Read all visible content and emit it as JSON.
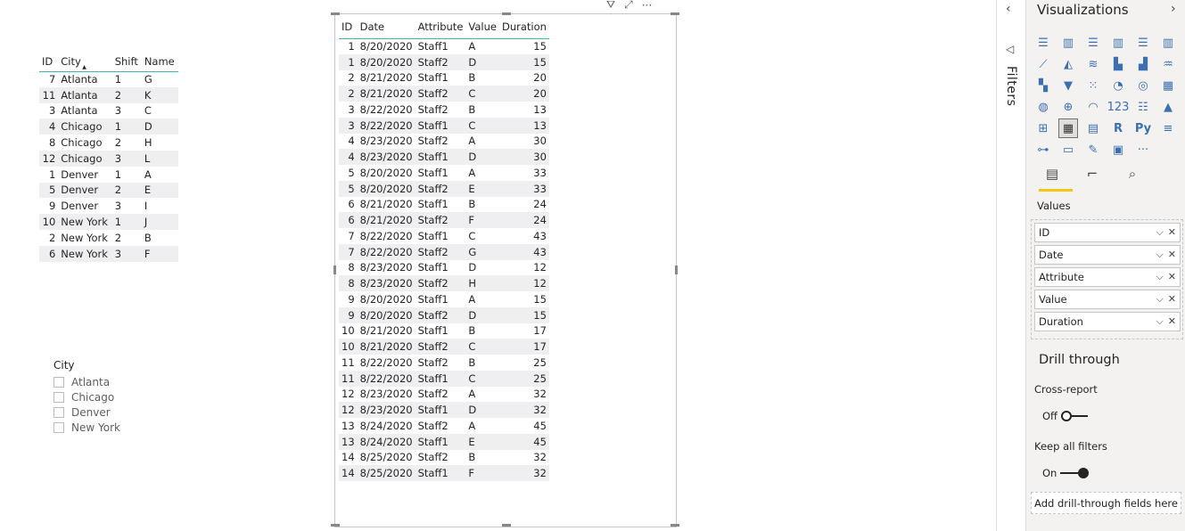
{
  "left_table": {
    "headers": [
      "ID",
      "City",
      "Shift",
      "Name"
    ],
    "rows": [
      [
        "7",
        "Atlanta",
        "1",
        "G"
      ],
      [
        "11",
        "Atlanta",
        "2",
        "K"
      ],
      [
        "3",
        "Atlanta",
        "3",
        "C"
      ],
      [
        "4",
        "Chicago",
        "1",
        "D"
      ],
      [
        "8",
        "Chicago",
        "2",
        "H"
      ],
      [
        "12",
        "Chicago",
        "3",
        "L"
      ],
      [
        "1",
        "Denver",
        "1",
        "A"
      ],
      [
        "5",
        "Denver",
        "2",
        "E"
      ],
      [
        "9",
        "Denver",
        "3",
        "I"
      ],
      [
        "10",
        "New York",
        "1",
        "J"
      ],
      [
        "2",
        "New York",
        "2",
        "B"
      ],
      [
        "6",
        "New York",
        "3",
        "F"
      ]
    ]
  },
  "slicer": {
    "title": "City",
    "items": [
      "Atlanta",
      "Chicago",
      "Denver",
      "New York"
    ]
  },
  "main_table": {
    "headers": [
      "ID",
      "Date",
      "Attribute",
      "Value",
      "Duration"
    ],
    "rows": [
      [
        "1",
        "8/20/2020",
        "Staff1",
        "A",
        "15"
      ],
      [
        "1",
        "8/20/2020",
        "Staff2",
        "D",
        "15"
      ],
      [
        "2",
        "8/21/2020",
        "Staff1",
        "B",
        "20"
      ],
      [
        "2",
        "8/21/2020",
        "Staff2",
        "C",
        "20"
      ],
      [
        "3",
        "8/22/2020",
        "Staff2",
        "B",
        "13"
      ],
      [
        "3",
        "8/22/2020",
        "Staff1",
        "C",
        "13"
      ],
      [
        "4",
        "8/23/2020",
        "Staff2",
        "A",
        "30"
      ],
      [
        "4",
        "8/23/2020",
        "Staff1",
        "D",
        "30"
      ],
      [
        "5",
        "8/20/2020",
        "Staff1",
        "A",
        "33"
      ],
      [
        "5",
        "8/20/2020",
        "Staff2",
        "E",
        "33"
      ],
      [
        "6",
        "8/21/2020",
        "Staff1",
        "B",
        "24"
      ],
      [
        "6",
        "8/21/2020",
        "Staff2",
        "F",
        "24"
      ],
      [
        "7",
        "8/22/2020",
        "Staff1",
        "C",
        "43"
      ],
      [
        "7",
        "8/22/2020",
        "Staff2",
        "G",
        "43"
      ],
      [
        "8",
        "8/23/2020",
        "Staff1",
        "D",
        "12"
      ],
      [
        "8",
        "8/23/2020",
        "Staff2",
        "H",
        "12"
      ],
      [
        "9",
        "8/20/2020",
        "Staff1",
        "A",
        "15"
      ],
      [
        "9",
        "8/20/2020",
        "Staff2",
        "D",
        "15"
      ],
      [
        "10",
        "8/21/2020",
        "Staff1",
        "B",
        "17"
      ],
      [
        "10",
        "8/21/2020",
        "Staff2",
        "C",
        "17"
      ],
      [
        "11",
        "8/22/2020",
        "Staff2",
        "B",
        "25"
      ],
      [
        "11",
        "8/22/2020",
        "Staff1",
        "C",
        "25"
      ],
      [
        "12",
        "8/23/2020",
        "Staff2",
        "A",
        "32"
      ],
      [
        "12",
        "8/23/2020",
        "Staff1",
        "D",
        "32"
      ],
      [
        "13",
        "8/24/2020",
        "Staff2",
        "A",
        "45"
      ],
      [
        "13",
        "8/24/2020",
        "Staff1",
        "E",
        "45"
      ],
      [
        "14",
        "8/25/2020",
        "Staff2",
        "B",
        "32"
      ],
      [
        "14",
        "8/25/2020",
        "Staff1",
        "F",
        "32"
      ]
    ]
  },
  "filters_pane": {
    "label": "Filters"
  },
  "viz_pane": {
    "title": "Visualizations",
    "values_label": "Values",
    "fields": [
      "ID",
      "Date",
      "Attribute",
      "Value",
      "Duration"
    ],
    "drill_through": {
      "title": "Drill through",
      "cross_report_label": "Cross-report",
      "cross_report_state": "Off",
      "keep_filters_label": "Keep all filters",
      "keep_filters_state": "On",
      "add_fields_label": "Add drill-through fields here"
    },
    "icons": [
      "stacked-bar-chart-icon",
      "stacked-column-chart-icon",
      "clustered-bar-chart-icon",
      "clustered-column-chart-icon",
      "100-stacked-bar-chart-icon",
      "100-stacked-column-chart-icon",
      "line-chart-icon",
      "area-chart-icon",
      "stacked-area-chart-icon",
      "line-and-stacked-column-icon",
      "line-and-clustered-column-icon",
      "ribbon-chart-icon",
      "waterfall-chart-icon",
      "funnel-icon",
      "scatter-chart-icon",
      "pie-chart-icon",
      "donut-chart-icon",
      "treemap-icon",
      "map-icon",
      "filled-map-icon",
      "gauge-icon",
      "card-icon",
      "multi-row-card-icon",
      "kpi-icon",
      "slicer-icon",
      "table-icon",
      "matrix-icon",
      "r-visual-icon",
      "python-visual-icon",
      "key-influencers-icon",
      "decomposition-tree-icon",
      "qa-icon",
      "smart-narrative-icon",
      "paginated-report-icon",
      "more-visuals-icon"
    ],
    "icon_glyphs": [
      "☰",
      "▥",
      "☰",
      "▥",
      "☰",
      "▥",
      "⟋",
      "◭",
      "≋",
      "▙",
      "▟",
      "♒",
      "▚",
      "▼",
      "⁙",
      "◔",
      "◎",
      "▦",
      "◍",
      "⊕",
      "◠",
      "123",
      "☷",
      "▲",
      "⊞",
      "▦",
      "▤",
      "R",
      "Py",
      "≡",
      "⊶",
      "▭",
      "✎",
      "▣",
      "···"
    ],
    "selected_icon_index": 25
  },
  "colors": {
    "accent_teal": "#41b6ae",
    "accent_yellow": "#f2c811",
    "icon_blue": "#3a6fb0"
  }
}
